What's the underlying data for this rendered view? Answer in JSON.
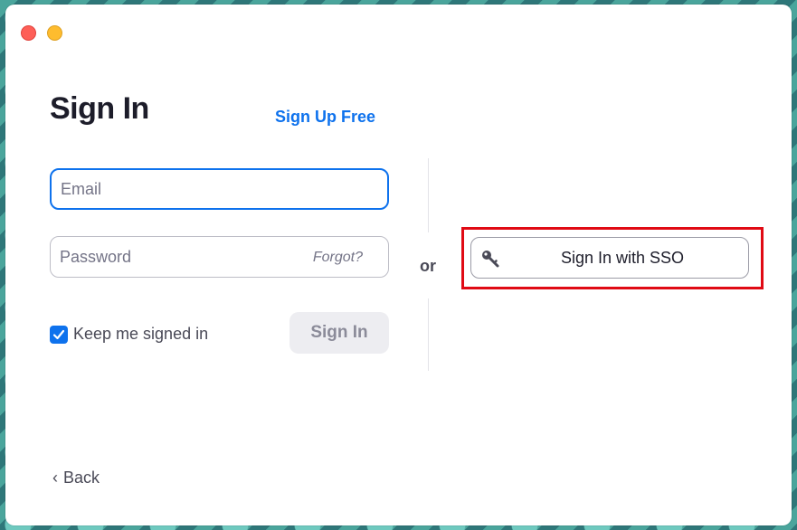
{
  "window": {
    "controls": [
      "close",
      "minimize"
    ]
  },
  "header": {
    "title": "Sign In",
    "signup_link": "Sign Up Free"
  },
  "form": {
    "email_placeholder": "Email",
    "password_placeholder": "Password",
    "forgot_link": "Forgot?",
    "keep_signed_in_label": "Keep me signed in",
    "keep_signed_in_checked": true,
    "signin_button": "Sign In"
  },
  "alt": {
    "or_label": "or",
    "sso_button": "Sign In with SSO",
    "sso_icon": "key-icon"
  },
  "footer": {
    "back_chevron": "‹",
    "back_label": "Back"
  },
  "colors": {
    "accent": "#0e72ed",
    "highlight_box": "#e00a14",
    "close": "#fe5f57",
    "minimize": "#febc2e"
  }
}
